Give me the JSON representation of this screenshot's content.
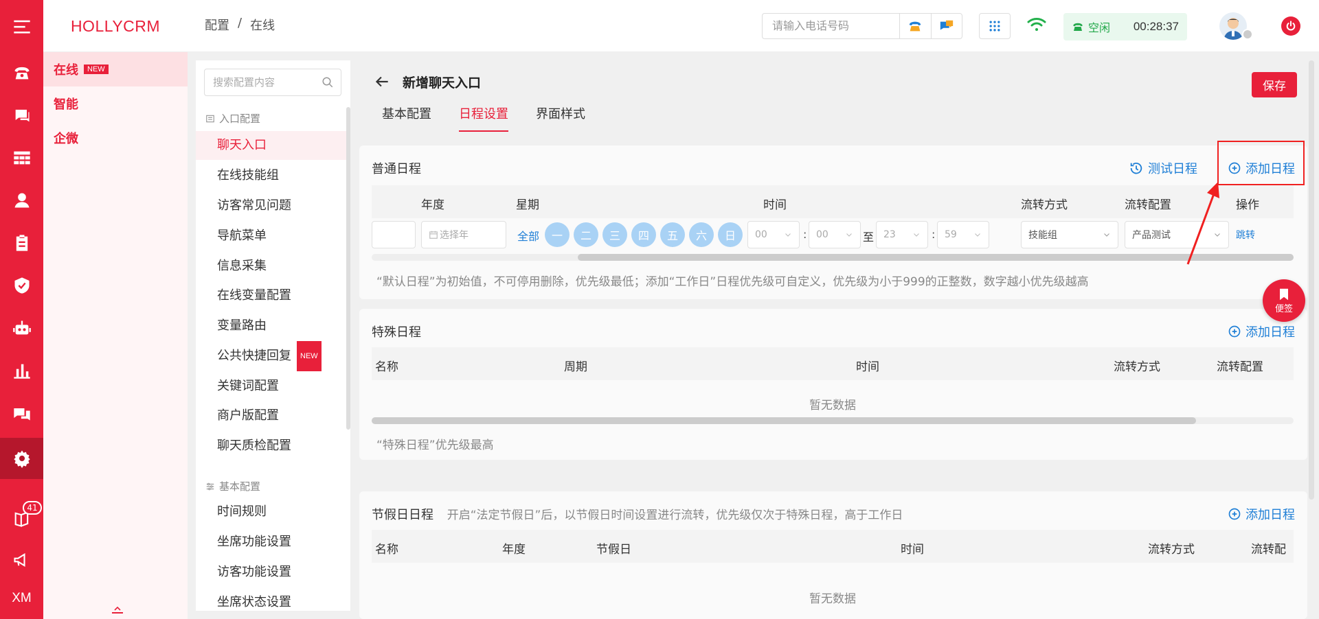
{
  "app": {
    "brand": "HOLLYCRM",
    "rail_text": "XM",
    "rail_badge": "41"
  },
  "breadcrumb": {
    "item1": "配置",
    "sep": "/",
    "item2": "在线"
  },
  "topbar": {
    "phone_placeholder": "请输入电话号码",
    "status": "空闲",
    "timer": "00:28:37"
  },
  "nav1": {
    "items": [
      {
        "label": "在线",
        "tag": "NEW"
      },
      {
        "label": "智能"
      },
      {
        "label": "企微"
      }
    ]
  },
  "nav2": {
    "search_placeholder": "搜索配置内容",
    "group1": "入口配置",
    "group1_items": [
      "聊天入口",
      "在线技能组",
      "访客常见问题",
      "导航菜单",
      "信息采集",
      "在线变量配置",
      "变量路由",
      "公共快捷回复",
      "关键词配置",
      "商户版配置",
      "聊天质检配置"
    ],
    "tag_new": "NEW",
    "group2": "基本配置",
    "group2_items": [
      "时间规则",
      "坐席功能设置",
      "访客功能设置",
      "坐席状态设置"
    ]
  },
  "page": {
    "title": "新增聊天入口",
    "save": "保存",
    "tabs": [
      "基本配置",
      "日程设置",
      "界面样式"
    ]
  },
  "normal": {
    "title": "普通日程",
    "test": "测试日程",
    "add": "添加日程",
    "headers": [
      "年度",
      "星期",
      "时间",
      "流转方式",
      "流转配置",
      "操作"
    ],
    "row": {
      "year_placeholder": "选择年",
      "all": "全部",
      "days": [
        "一",
        "二",
        "三",
        "四",
        "五",
        "六",
        "日"
      ],
      "start_h": "00",
      "start_m": "00",
      "to": "至",
      "end_h": "23",
      "end_m": "59",
      "colon": ":",
      "mode": "技能组",
      "config": "产品测试",
      "action": "跳转"
    },
    "note": "“默认日程”为初始值，不可停用删除，优先级最低；添加“工作日”日程优先级可自定义，优先级为小于999的正整数，数字越小优先级越高"
  },
  "special": {
    "title": "特殊日程",
    "add": "添加日程",
    "headers": [
      "名称",
      "周期",
      "时间",
      "流转方式",
      "流转配置"
    ],
    "empty": "暂无数据",
    "note": "“特殊日程”优先级最高"
  },
  "holiday": {
    "title": "节假日日程",
    "desc": "开启“法定节假日”后，以节假日时间设置进行流转，优先级仅次于特殊日程，高于工作日",
    "add": "添加日程",
    "headers": [
      "名称",
      "年度",
      "节假日",
      "时间",
      "流转方式",
      "流转配"
    ],
    "empty": "暂无数据"
  },
  "float": {
    "label": "便签"
  },
  "colors": {
    "brand": "#e8203a",
    "link": "#1f7fd6",
    "day": "#a9d2f5"
  }
}
